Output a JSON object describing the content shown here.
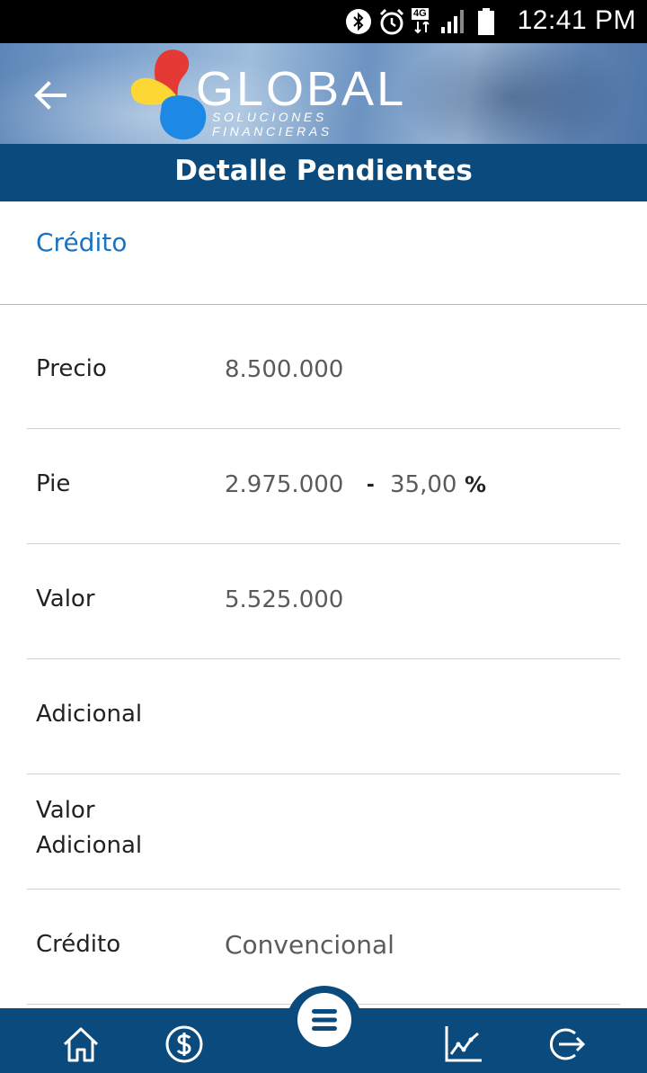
{
  "status_bar": {
    "network": "4G",
    "time": "12:41 PM",
    "icons": [
      "bluetooth-icon",
      "alarm-icon",
      "signal-icon",
      "battery-icon"
    ]
  },
  "header": {
    "brand_name": "GLOBAL",
    "brand_tagline": "SOLUCIONES FINANCIERAS",
    "title": "Detalle Pendientes"
  },
  "section": {
    "title": "Crédito"
  },
  "details": [
    {
      "label": "Precio",
      "value": "8.500.000"
    },
    {
      "label": "Pie",
      "value": "2.975.000",
      "separator": "-",
      "percent": "35,00",
      "percent_sign": "%"
    },
    {
      "label": "Valor",
      "value": "5.525.000"
    },
    {
      "label": "Adicional",
      "value": ""
    },
    {
      "label": "Valor Adicional",
      "value": ""
    },
    {
      "label": "Crédito",
      "value": "Convencional"
    }
  ],
  "bottom_nav": {
    "items": [
      "home-icon",
      "dollar-icon",
      "menu-icon",
      "chart-icon",
      "logout-icon"
    ]
  },
  "colors": {
    "primary": "#0b4a7c",
    "accent": "#1a73c2",
    "logo_red": "#e53935",
    "logo_yellow": "#fdd835",
    "logo_blue": "#1e88e5"
  }
}
